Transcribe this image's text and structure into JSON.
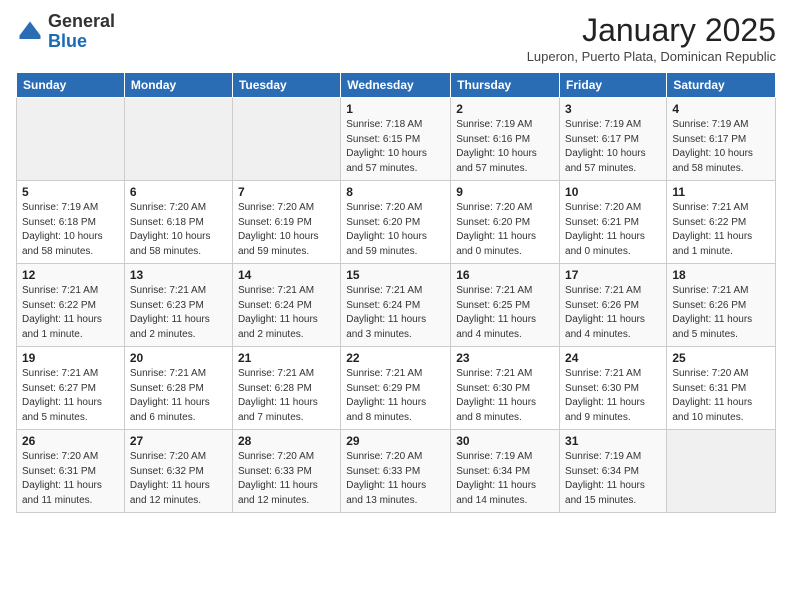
{
  "logo": {
    "general": "General",
    "blue": "Blue"
  },
  "header": {
    "month_title": "January 2025",
    "subtitle": "Luperon, Puerto Plata, Dominican Republic"
  },
  "days_of_week": [
    "Sunday",
    "Monday",
    "Tuesday",
    "Wednesday",
    "Thursday",
    "Friday",
    "Saturday"
  ],
  "weeks": [
    [
      {
        "day": "",
        "info": ""
      },
      {
        "day": "",
        "info": ""
      },
      {
        "day": "",
        "info": ""
      },
      {
        "day": "1",
        "info": "Sunrise: 7:18 AM\nSunset: 6:15 PM\nDaylight: 10 hours and 57 minutes."
      },
      {
        "day": "2",
        "info": "Sunrise: 7:19 AM\nSunset: 6:16 PM\nDaylight: 10 hours and 57 minutes."
      },
      {
        "day": "3",
        "info": "Sunrise: 7:19 AM\nSunset: 6:17 PM\nDaylight: 10 hours and 57 minutes."
      },
      {
        "day": "4",
        "info": "Sunrise: 7:19 AM\nSunset: 6:17 PM\nDaylight: 10 hours and 58 minutes."
      }
    ],
    [
      {
        "day": "5",
        "info": "Sunrise: 7:19 AM\nSunset: 6:18 PM\nDaylight: 10 hours and 58 minutes."
      },
      {
        "day": "6",
        "info": "Sunrise: 7:20 AM\nSunset: 6:18 PM\nDaylight: 10 hours and 58 minutes."
      },
      {
        "day": "7",
        "info": "Sunrise: 7:20 AM\nSunset: 6:19 PM\nDaylight: 10 hours and 59 minutes."
      },
      {
        "day": "8",
        "info": "Sunrise: 7:20 AM\nSunset: 6:20 PM\nDaylight: 10 hours and 59 minutes."
      },
      {
        "day": "9",
        "info": "Sunrise: 7:20 AM\nSunset: 6:20 PM\nDaylight: 11 hours and 0 minutes."
      },
      {
        "day": "10",
        "info": "Sunrise: 7:20 AM\nSunset: 6:21 PM\nDaylight: 11 hours and 0 minutes."
      },
      {
        "day": "11",
        "info": "Sunrise: 7:21 AM\nSunset: 6:22 PM\nDaylight: 11 hours and 1 minute."
      }
    ],
    [
      {
        "day": "12",
        "info": "Sunrise: 7:21 AM\nSunset: 6:22 PM\nDaylight: 11 hours and 1 minute."
      },
      {
        "day": "13",
        "info": "Sunrise: 7:21 AM\nSunset: 6:23 PM\nDaylight: 11 hours and 2 minutes."
      },
      {
        "day": "14",
        "info": "Sunrise: 7:21 AM\nSunset: 6:24 PM\nDaylight: 11 hours and 2 minutes."
      },
      {
        "day": "15",
        "info": "Sunrise: 7:21 AM\nSunset: 6:24 PM\nDaylight: 11 hours and 3 minutes."
      },
      {
        "day": "16",
        "info": "Sunrise: 7:21 AM\nSunset: 6:25 PM\nDaylight: 11 hours and 4 minutes."
      },
      {
        "day": "17",
        "info": "Sunrise: 7:21 AM\nSunset: 6:26 PM\nDaylight: 11 hours and 4 minutes."
      },
      {
        "day": "18",
        "info": "Sunrise: 7:21 AM\nSunset: 6:26 PM\nDaylight: 11 hours and 5 minutes."
      }
    ],
    [
      {
        "day": "19",
        "info": "Sunrise: 7:21 AM\nSunset: 6:27 PM\nDaylight: 11 hours and 5 minutes."
      },
      {
        "day": "20",
        "info": "Sunrise: 7:21 AM\nSunset: 6:28 PM\nDaylight: 11 hours and 6 minutes."
      },
      {
        "day": "21",
        "info": "Sunrise: 7:21 AM\nSunset: 6:28 PM\nDaylight: 11 hours and 7 minutes."
      },
      {
        "day": "22",
        "info": "Sunrise: 7:21 AM\nSunset: 6:29 PM\nDaylight: 11 hours and 8 minutes."
      },
      {
        "day": "23",
        "info": "Sunrise: 7:21 AM\nSunset: 6:30 PM\nDaylight: 11 hours and 8 minutes."
      },
      {
        "day": "24",
        "info": "Sunrise: 7:21 AM\nSunset: 6:30 PM\nDaylight: 11 hours and 9 minutes."
      },
      {
        "day": "25",
        "info": "Sunrise: 7:20 AM\nSunset: 6:31 PM\nDaylight: 11 hours and 10 minutes."
      }
    ],
    [
      {
        "day": "26",
        "info": "Sunrise: 7:20 AM\nSunset: 6:31 PM\nDaylight: 11 hours and 11 minutes."
      },
      {
        "day": "27",
        "info": "Sunrise: 7:20 AM\nSunset: 6:32 PM\nDaylight: 11 hours and 12 minutes."
      },
      {
        "day": "28",
        "info": "Sunrise: 7:20 AM\nSunset: 6:33 PM\nDaylight: 11 hours and 12 minutes."
      },
      {
        "day": "29",
        "info": "Sunrise: 7:20 AM\nSunset: 6:33 PM\nDaylight: 11 hours and 13 minutes."
      },
      {
        "day": "30",
        "info": "Sunrise: 7:19 AM\nSunset: 6:34 PM\nDaylight: 11 hours and 14 minutes."
      },
      {
        "day": "31",
        "info": "Sunrise: 7:19 AM\nSunset: 6:34 PM\nDaylight: 11 hours and 15 minutes."
      },
      {
        "day": "",
        "info": ""
      }
    ]
  ]
}
